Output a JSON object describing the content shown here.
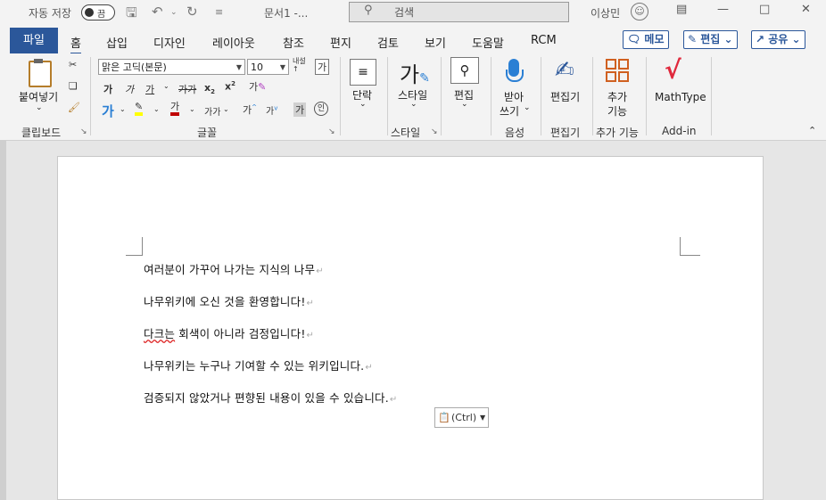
{
  "titlebar": {
    "autosave_label": "자동 저장",
    "autosave_state": "끔",
    "doc_title": "문서1  -...",
    "search_placeholder": "검색",
    "user_name": "이상민"
  },
  "tabs": [
    "파일",
    "홈",
    "삽입",
    "디자인",
    "레이아웃",
    "참조",
    "편지",
    "검토",
    "보기",
    "도움말",
    "RCM"
  ],
  "top_buttons": {
    "memo": "메모",
    "edit": "편집",
    "share": "공유"
  },
  "ribbon": {
    "clipboard": {
      "paste": "붙여넣기",
      "group": "클립보드"
    },
    "font": {
      "font_name": "맑은 고딕(본문)",
      "font_size": "10",
      "group": "글꼴"
    },
    "paragraph": {
      "label": "단락"
    },
    "styles": {
      "label": "스타일",
      "group": "스타일"
    },
    "editing": {
      "label": "편집"
    },
    "voice": {
      "label1": "받아",
      "label2": "쓰기",
      "group": "음성"
    },
    "editor": {
      "label": "편집기",
      "group": "편집기"
    },
    "addins": {
      "label1": "추가",
      "label2": "기능",
      "group": "추가 기능"
    },
    "mathtype": {
      "label": "MathType",
      "group": "Add-in"
    }
  },
  "document": {
    "paragraphs": [
      "여러분이 가꾸어 나가는 지식의 나무",
      "나무위키에 오신 것을 환영합니다!",
      "다크는 회색이 아니라 검정입니다!",
      "나무위키는 누구나 기여할 수 있는 위키입니다.",
      "검증되지 않았거나 편향된 내용이 있을 수 있습니다."
    ],
    "misspelled_word": "다크는",
    "paste_options_label": "(Ctrl)"
  },
  "colors": {
    "accent": "#2b579a",
    "highlight": "#ffff00",
    "font_color": "#c00000"
  }
}
